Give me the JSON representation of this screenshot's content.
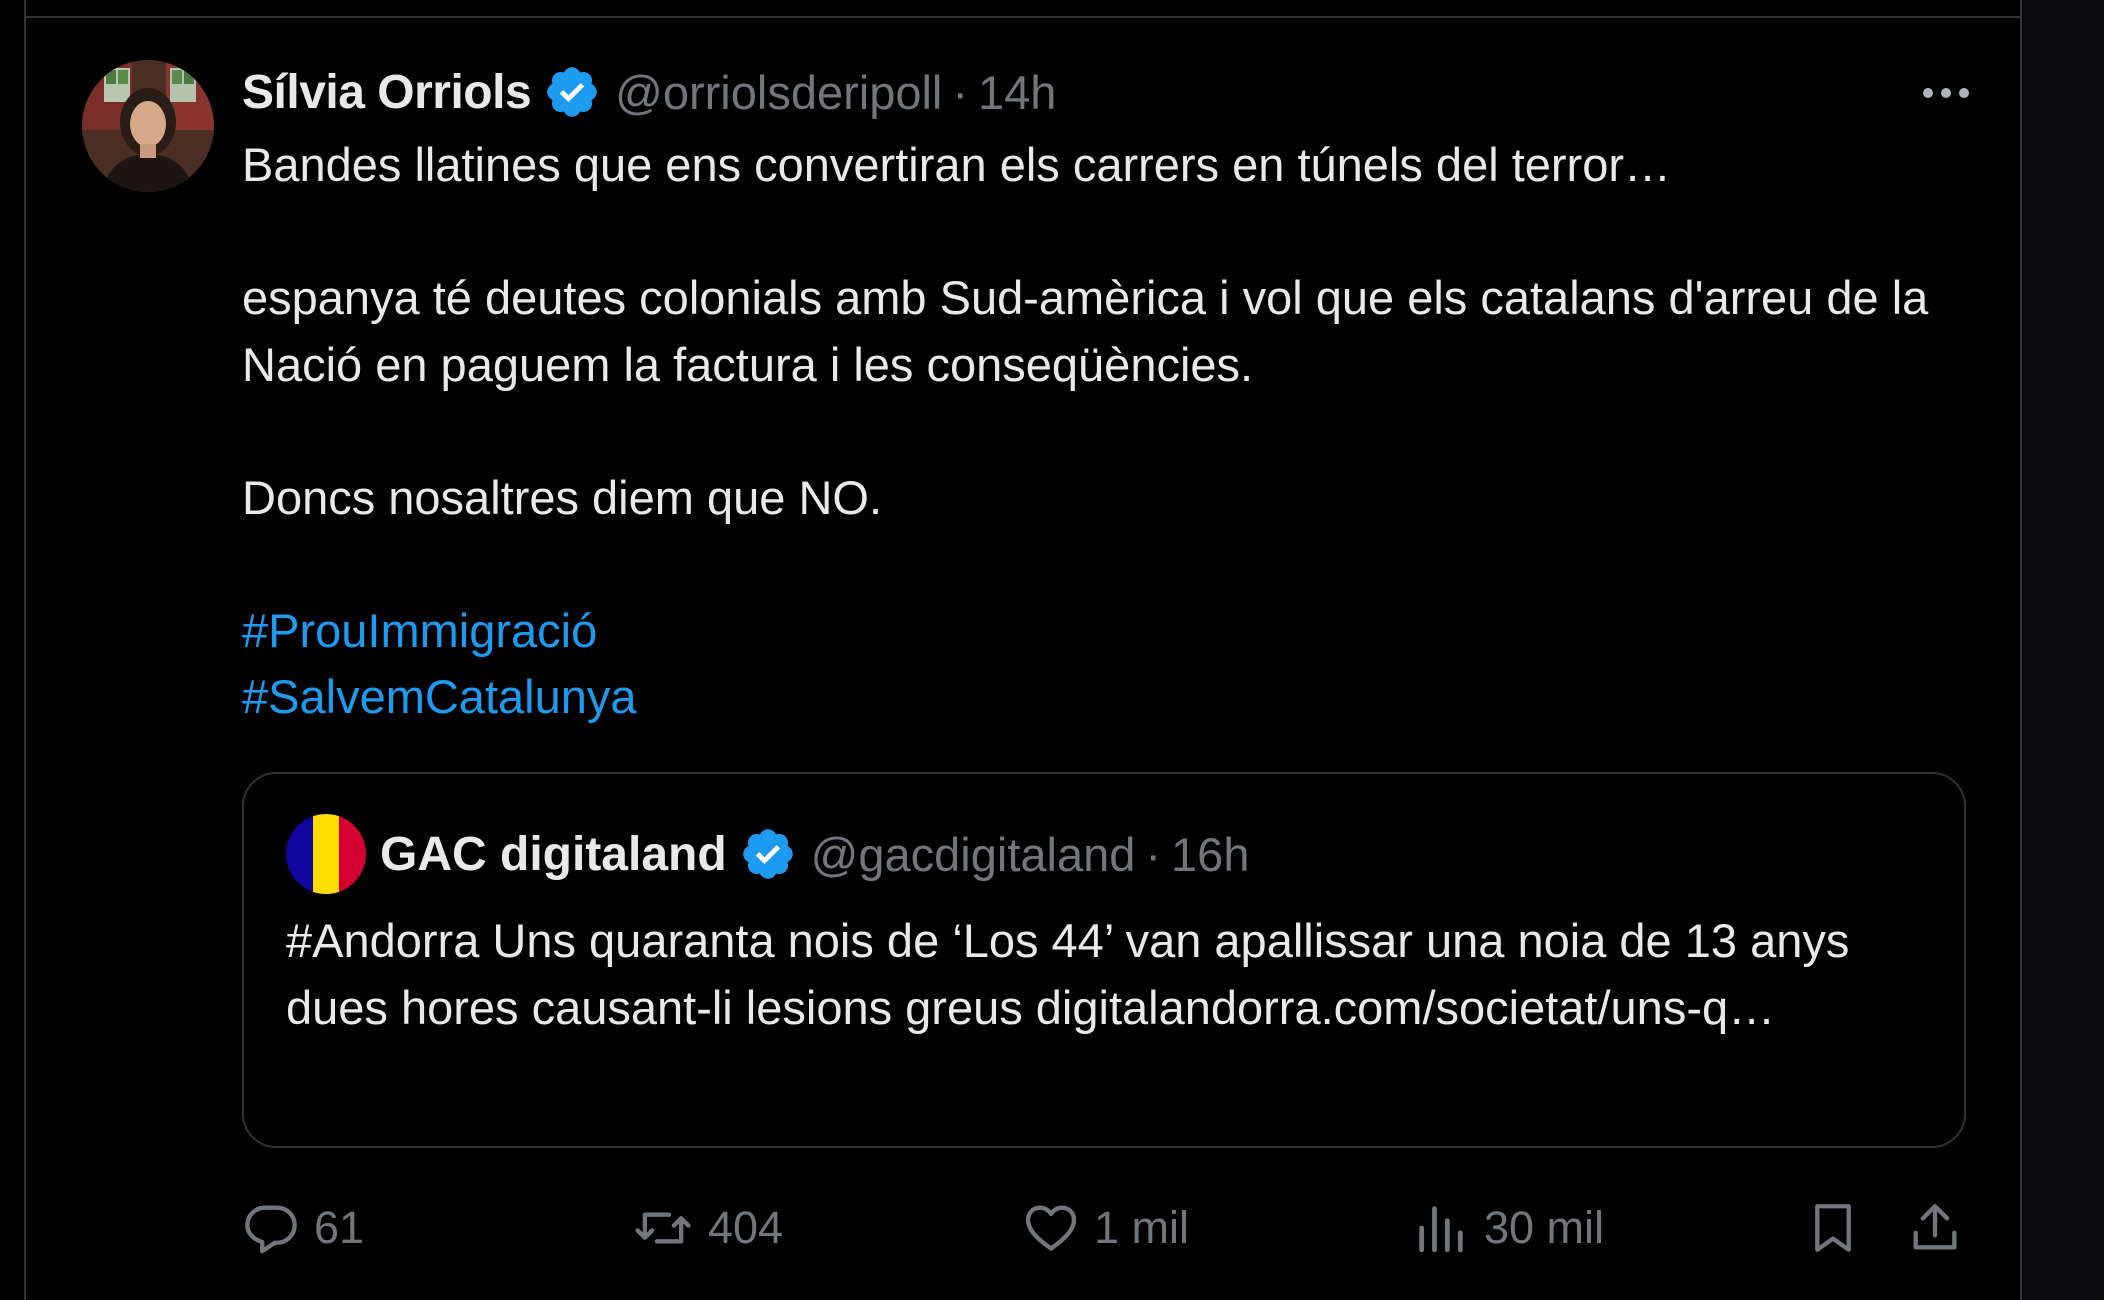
{
  "tweet": {
    "author": {
      "display_name": "Sílvia Orriols",
      "handle": "@orriolsderipoll",
      "time": "14h",
      "separator": "·",
      "verified": true
    },
    "paragraphs": [
      "Bandes llatines que ens convertiran els carrers en túnels del terror…",
      "espanya té deutes colonials amb Sud-amèrica i vol que els catalans d'arreu de la Nació en paguem la factura i les conseqüències.",
      "Doncs nosaltres diem que NO."
    ],
    "hashtags": [
      "#ProuImmigració",
      "#SalvemCatalunya"
    ]
  },
  "quote": {
    "author": {
      "display_name": "GAC digitaland",
      "handle": "@gacdigitaland",
      "time": "16h",
      "separator": "·",
      "verified": true
    },
    "text": "#Andorra Uns quaranta nois de ‘Los 44’ van apallissar una noia de 13 anys dues hores causant-li lesions greus digitalandorra.com/societat/uns-q…"
  },
  "actions": {
    "replies": "61",
    "reposts": "404",
    "likes": "1 mil",
    "views": "30 mil"
  },
  "icons": {
    "more": "more-horizontal-icon",
    "verified": "verified-badge-icon",
    "reply": "reply-icon",
    "repost": "repost-icon",
    "like": "heart-icon",
    "views": "views-chart-icon",
    "bookmark": "bookmark-icon",
    "share": "share-icon"
  },
  "colors": {
    "background": "#000000",
    "text": "#e7e9ea",
    "secondary": "#71767b",
    "accent": "#1d9bf0",
    "border": "#2f3336",
    "andorra_flag": [
      "#10069f",
      "#fedd00",
      "#d50032"
    ]
  }
}
